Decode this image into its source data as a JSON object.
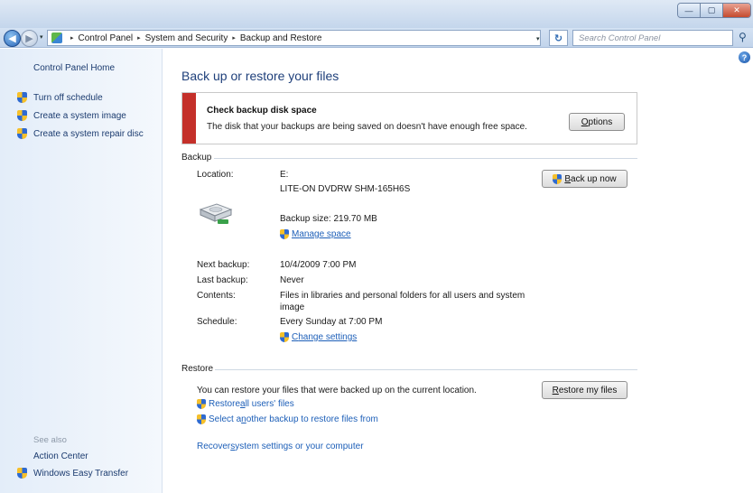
{
  "window": {
    "minimize_glyph": "—",
    "maximize_glyph": "▢",
    "close_glyph": "✕"
  },
  "nav": {
    "back_glyph": "◀",
    "forward_glyph": "▶",
    "breadcrumb": [
      "Control Panel",
      "System and Security",
      "Backup and Restore"
    ],
    "separator": "▸",
    "dropdown_glyph": "▾",
    "refresh_glyph": "↻",
    "search_placeholder": "Search Control Panel",
    "search_glyph": "⚲"
  },
  "left_pane": {
    "home": "Control Panel Home",
    "tasks": [
      "Turn off schedule",
      "Create a system image",
      "Create a system repair disc"
    ],
    "see_also_title": "See also",
    "see_also": [
      "Action Center",
      "Windows Easy Transfer"
    ]
  },
  "main": {
    "help_glyph": "?",
    "title": "Back up or restore your files",
    "banner": {
      "title": "Check backup disk space",
      "message": "The disk that your backups are being saved on doesn't have enough free space.",
      "button_first": "O",
      "button_rest": "ptions"
    },
    "backup": {
      "section": "Backup",
      "location_label": "Location:",
      "location_drive": "E:",
      "location_device": "LITE-ON DVDRW SHM-165H6S",
      "backup_size": "Backup size: 219.70 MB",
      "manage_first": "M",
      "manage_rest": "anage space",
      "backup_btn_first": "B",
      "backup_btn_rest": "ack up now",
      "next_label": "Next backup:",
      "next_value": "10/4/2009 7:00 PM",
      "last_label": "Last backup:",
      "last_value": "Never",
      "contents_label": "Contents:",
      "contents_value_1": "Files in libraries and personal folders for all users and system",
      "contents_value_2": "image",
      "schedule_label": "Schedule:",
      "schedule_value": "Every Sunday at 7:00 PM",
      "change_first": "C",
      "change_rest": "hange settings"
    },
    "restore": {
      "section": "Restore",
      "description": "You can restore your files that were backed up on the current location.",
      "restore_btn_first": "R",
      "restore_btn_rest": "estore my files",
      "all_users_pre": "Restore ",
      "all_users_key": "a",
      "all_users_post": "ll users' files",
      "another_pre": "Select a",
      "another_key": "n",
      "another_post": "other backup to restore files from",
      "recover_pre": "Recover ",
      "recover_key": "s",
      "recover_post": "ystem settings or your computer"
    }
  }
}
